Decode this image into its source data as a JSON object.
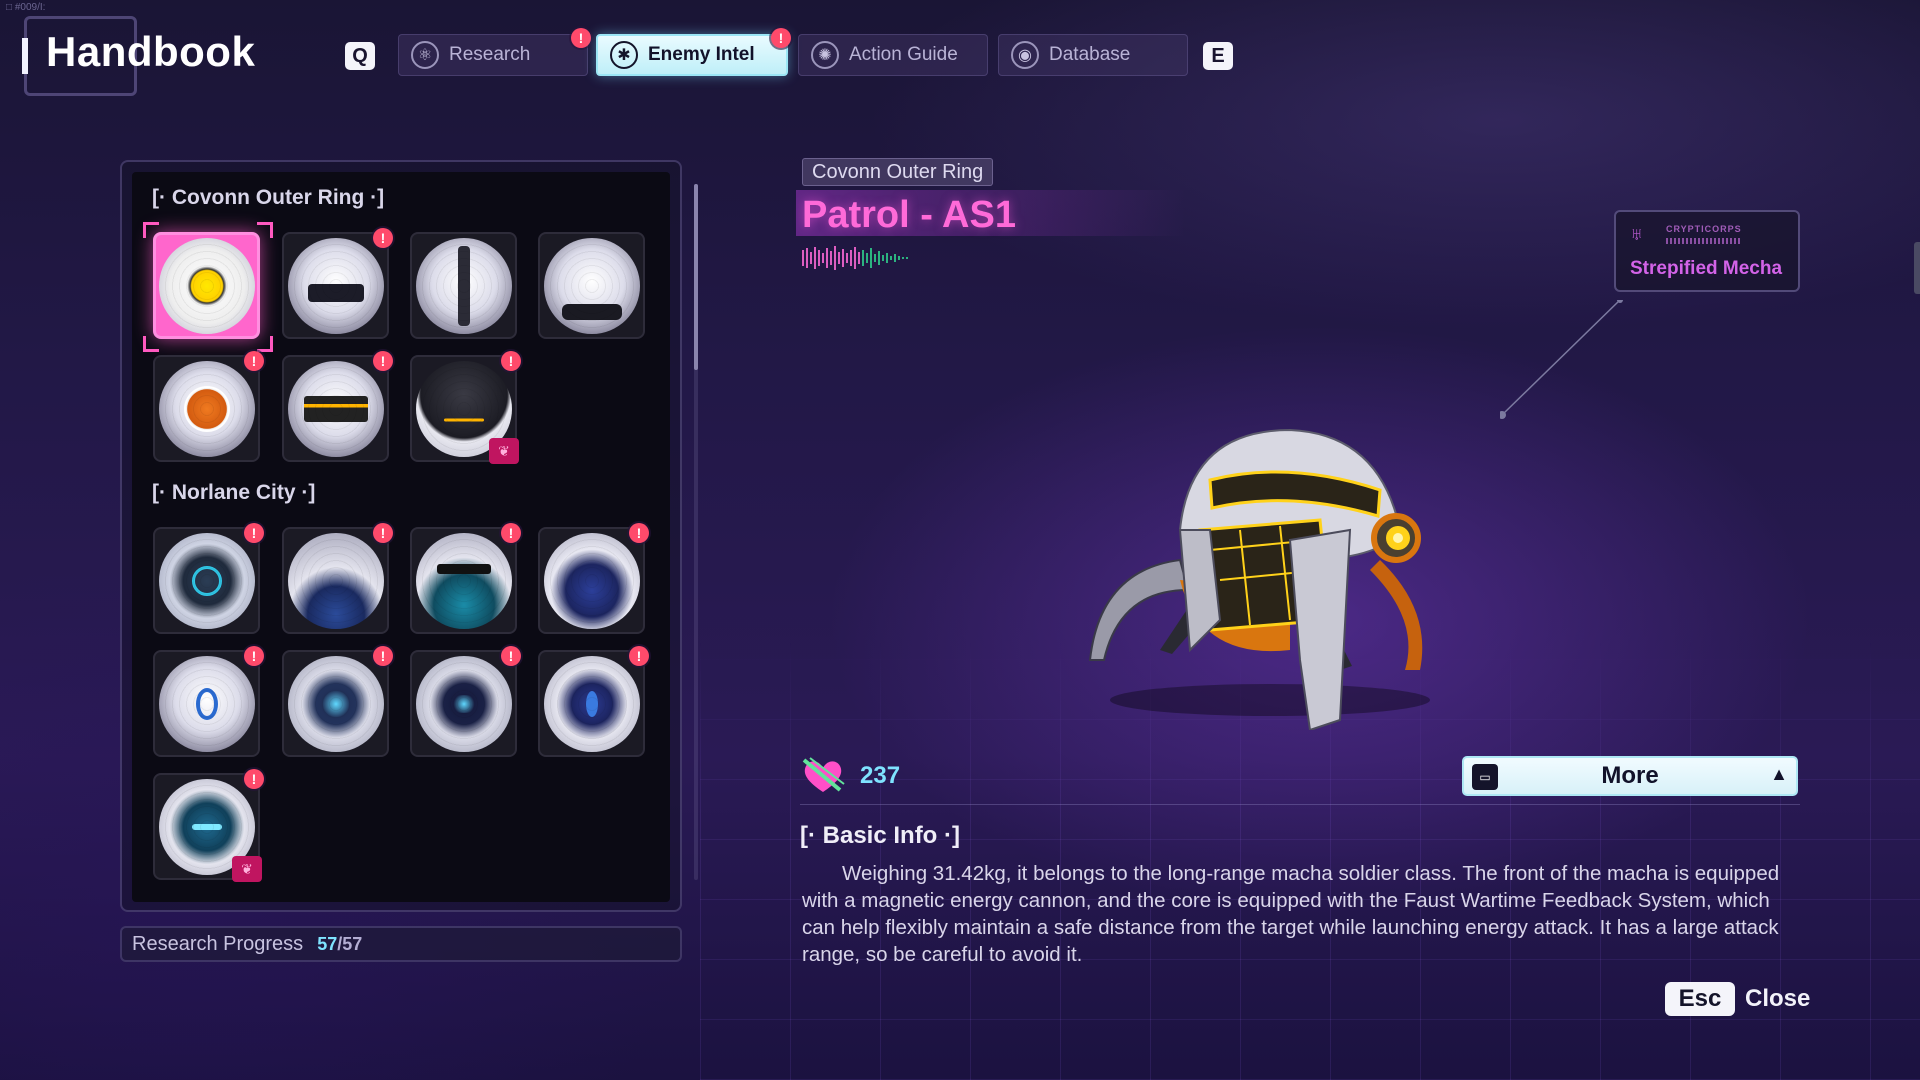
{
  "header": {
    "title": "Handbook",
    "subtitle": "□ #009/I:",
    "left_key": "Q",
    "right_key": "E",
    "tabs": [
      {
        "label": "Research",
        "icon": "research-icon",
        "alert": "!"
      },
      {
        "label": "Enemy Intel",
        "icon": "enemy-intel-icon",
        "alert": "!",
        "active": true
      },
      {
        "label": "Action Guide",
        "icon": "action-guide-icon"
      },
      {
        "label": "Database",
        "icon": "database-icon"
      }
    ]
  },
  "list": {
    "sections": [
      {
        "title": "[· Covonn Outer Ring ·]",
        "entries": [
          {
            "id": "patrol-as1",
            "selected": true
          },
          {
            "id": "enemy-2",
            "alert": "!"
          },
          {
            "id": "enemy-3"
          },
          {
            "id": "enemy-4"
          },
          {
            "id": "enemy-5",
            "alert": "!"
          },
          {
            "id": "enemy-6",
            "alert": "!"
          },
          {
            "id": "enemy-7",
            "alert": "!",
            "badge": "elite"
          }
        ]
      },
      {
        "title": "[· Norlane City ·]",
        "entries": [
          {
            "id": "enemy-8",
            "alert": "!"
          },
          {
            "id": "enemy-9",
            "alert": "!"
          },
          {
            "id": "enemy-10",
            "alert": "!"
          },
          {
            "id": "enemy-11",
            "alert": "!"
          },
          {
            "id": "enemy-12",
            "alert": "!"
          },
          {
            "id": "enemy-13",
            "alert": "!"
          },
          {
            "id": "enemy-14",
            "alert": "!"
          },
          {
            "id": "enemy-15",
            "alert": "!"
          },
          {
            "id": "enemy-16",
            "alert": "!",
            "badge": "elite"
          }
        ]
      }
    ],
    "scroll_position": 0
  },
  "progress": {
    "label": "Research Progress",
    "current": "57",
    "total": "/57"
  },
  "detail": {
    "region": "Covonn Outer Ring",
    "name": "Patrol - AS1",
    "faction": {
      "corp": "CRYPTICORPS",
      "name": "Strepified Mecha"
    },
    "stat_value": "237",
    "more_label": "More",
    "info_heading": "[· Basic Info ·]",
    "info_text": "Weighing 31.42kg, it belongs to the long-range macha soldier class. The front of the macha is equipped with a magnetic energy cannon, and the core is equipped with the Faust Wartime Feedback System, which can help flexibly maintain a safe distance from the target while launching energy attack. It has a large attack range, so be careful to avoid it."
  },
  "footer": {
    "esc_key": "Esc",
    "close_label": "Close"
  },
  "colors": {
    "accent_pink": "#ff6ad8",
    "accent_cyan": "#7fe3ff",
    "alert_red": "#ff4a6b"
  }
}
